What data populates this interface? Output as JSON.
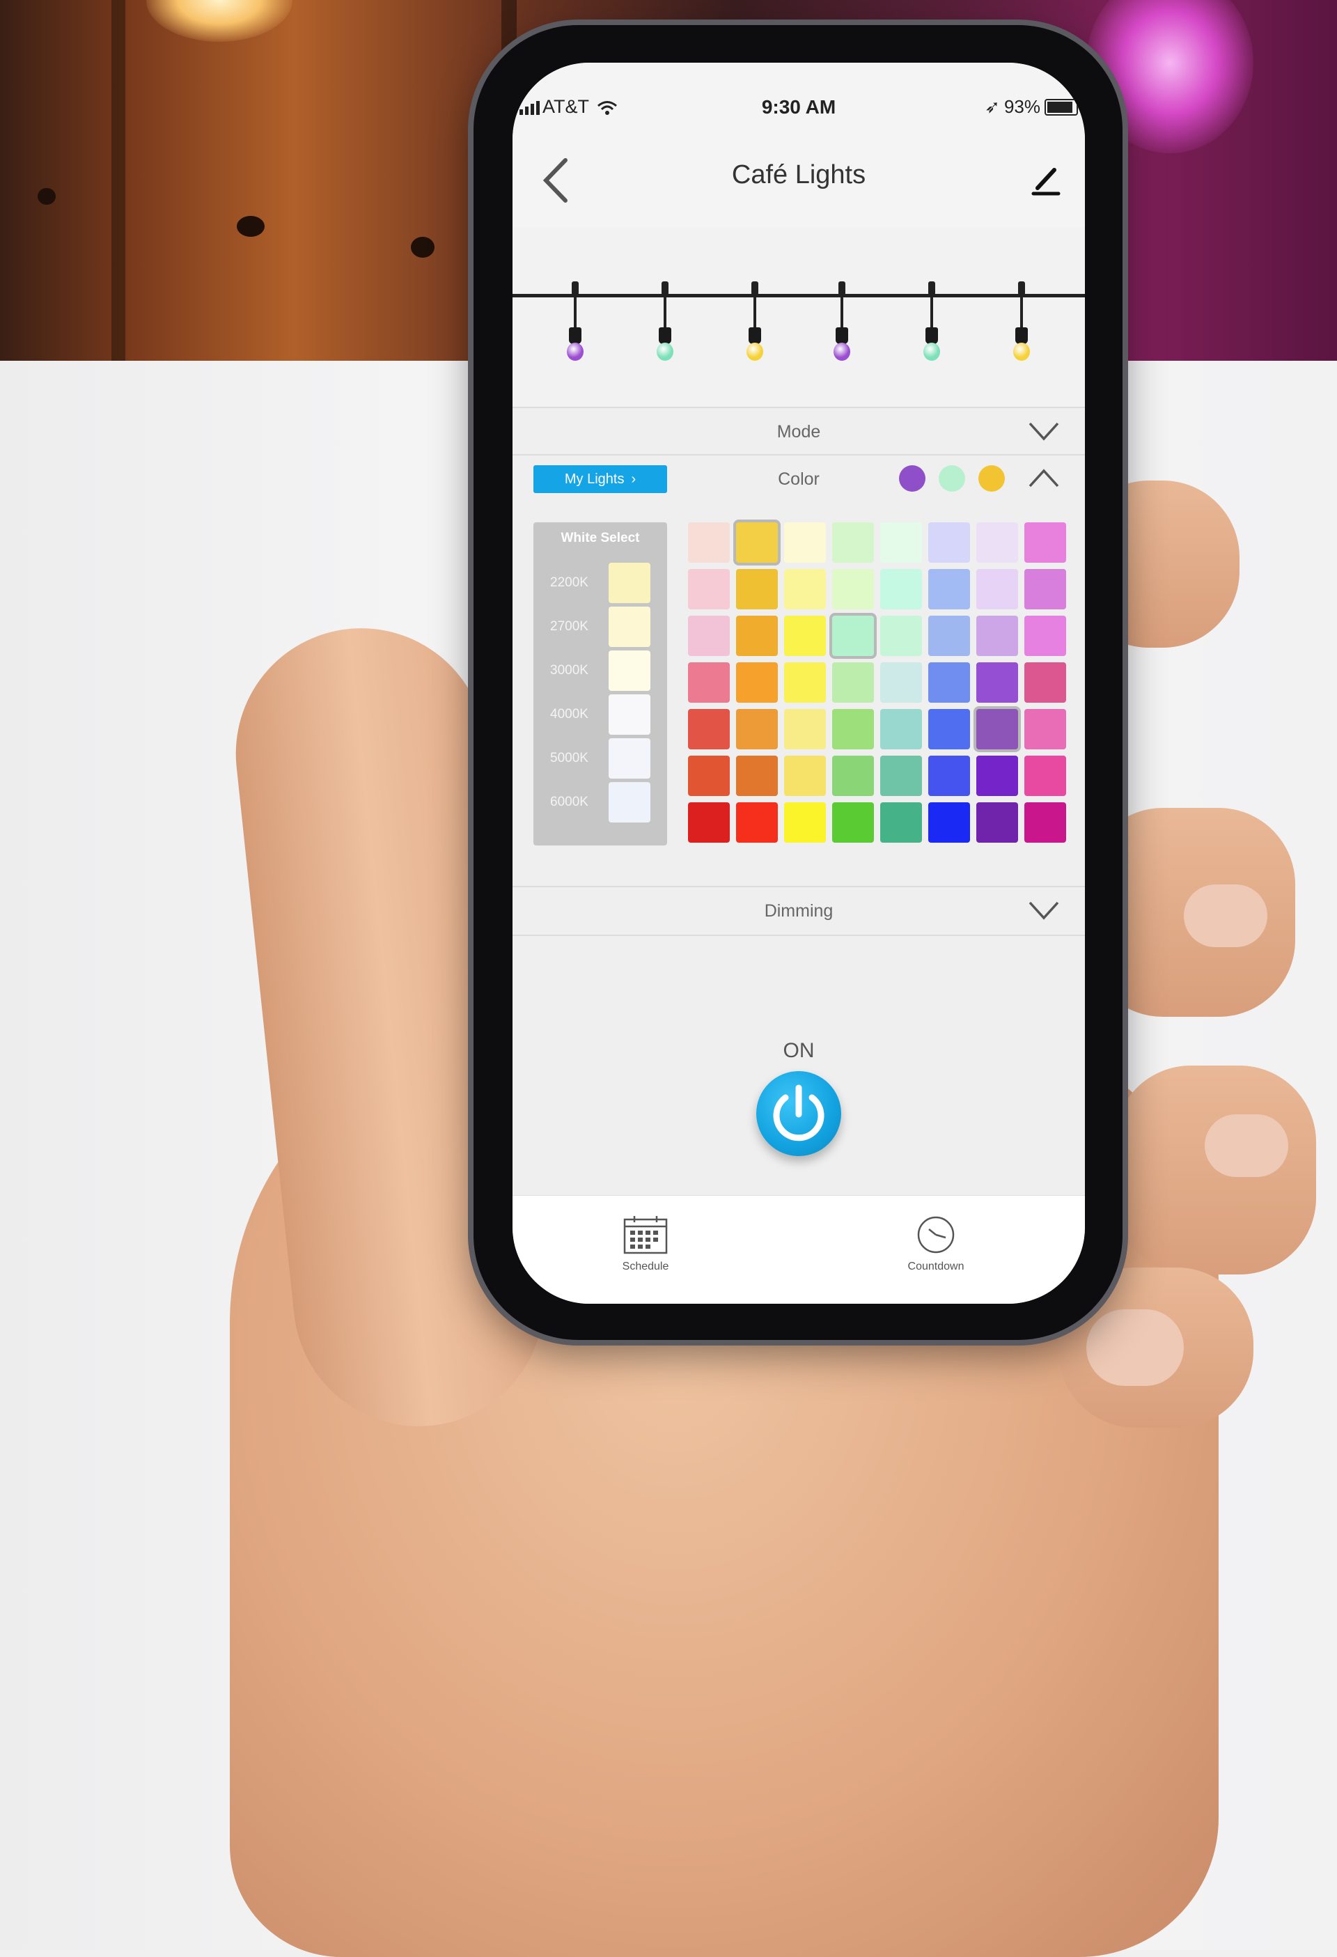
{
  "status_bar": {
    "carrier": "AT&T",
    "time": "9:30 AM",
    "battery": "93%"
  },
  "nav": {
    "title": "Café Lights",
    "back_icon": "chevron-left-icon",
    "edit_icon": "pencil-icon"
  },
  "bulbs": [
    {
      "color": "#9b4fd0"
    },
    {
      "color": "#7de0b8"
    },
    {
      "color": "#f5d23a"
    },
    {
      "color": "#9b4fd0"
    },
    {
      "color": "#7de0b8"
    },
    {
      "color": "#f5d23a"
    }
  ],
  "mode_row": {
    "label": "Mode",
    "state": "collapsed"
  },
  "color_row": {
    "label": "Color",
    "my_lights_button": "My Lights",
    "state": "expanded",
    "selected_colors": [
      "#8e4fc9",
      "#b6f0cf",
      "#f2c431"
    ]
  },
  "white_select": {
    "title": "White Select",
    "options": [
      {
        "label": "2200K",
        "color": "#fbf3bd"
      },
      {
        "label": "2700K",
        "color": "#fdf7d4"
      },
      {
        "label": "3000K",
        "color": "#fefbe6"
      },
      {
        "label": "4000K",
        "color": "#f8f8fb"
      },
      {
        "label": "5000K",
        "color": "#f3f5fb"
      },
      {
        "label": "6000K",
        "color": "#eef2fb"
      }
    ]
  },
  "color_grid": {
    "rows": [
      [
        "#f7ddd6",
        "#f3cf45",
        "#fdf9d4",
        "#d5f6cb",
        "#e4fbe9",
        "#d6d6fa",
        "#ece0f7",
        "#e880dd"
      ],
      [
        "#f6cbd6",
        "#f0c033",
        "#fbf59a",
        "#dff9c7",
        "#c6f9e3",
        "#a3bbf4",
        "#e6d3f5",
        "#d87edc"
      ],
      [
        "#f2c3d6",
        "#efac2d",
        "#faf34b",
        "#b4f2cd",
        "#c6f5d8",
        "#9fb7f1",
        "#cca6e6",
        "#e680e1"
      ],
      [
        "#ec7a90",
        "#f5a12c",
        "#faf254",
        "#bcedac",
        "#cdeae8",
        "#6f8ef0",
        "#944fd2",
        "#dc5790"
      ],
      [
        "#e25446",
        "#ec9b37",
        "#f7ec88",
        "#9ddf7b",
        "#99d8cf",
        "#4f6ef0",
        "#8d55b8",
        "#e86cb6"
      ],
      [
        "#e25532",
        "#e1772c",
        "#f6e268",
        "#8ad677",
        "#6fc3a6",
        "#4553ef",
        "#7424c9",
        "#e84aa2"
      ],
      [
        "#dc1f1f",
        "#f62e1c",
        "#fbf42a",
        "#5bcb33",
        "#45b387",
        "#1b29f4",
        "#6f24ab",
        "#c9168c"
      ]
    ],
    "selected": [
      [
        0,
        1
      ],
      [
        2,
        3
      ],
      [
        4,
        6
      ]
    ]
  },
  "dimming_row": {
    "label": "Dimming",
    "state": "collapsed"
  },
  "power": {
    "label": "ON",
    "icon": "power-icon",
    "accent": "#12a2e0"
  },
  "tabbar": {
    "schedule": {
      "label": "Schedule",
      "icon": "calendar-icon"
    },
    "countdown": {
      "label": "Countdown",
      "icon": "clock-icon"
    }
  }
}
